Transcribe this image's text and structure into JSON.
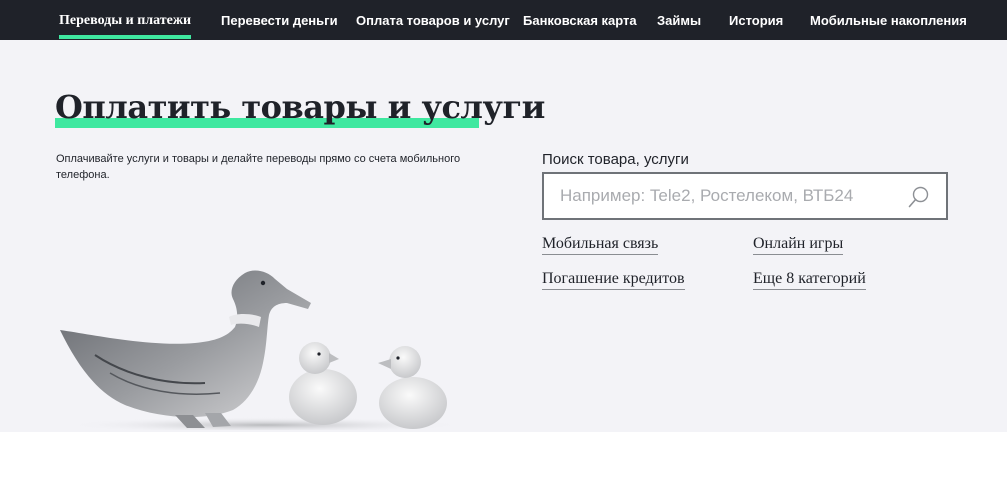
{
  "nav": {
    "items": [
      {
        "label": "Переводы и платежи",
        "active": true
      },
      {
        "label": "Перевести деньги"
      },
      {
        "label": "Оплата товаров и услуг"
      },
      {
        "label": "Банковская карта"
      },
      {
        "label": "Займы"
      },
      {
        "label": "История"
      },
      {
        "label": "Мобильные накопления"
      }
    ]
  },
  "hero": {
    "title": "Оплатить товары и услуги",
    "description": "Оплачивайте услуги и товары и делайте переводы прямо со счета мобильного телефона.",
    "accent_color": "#3fe8a0"
  },
  "search": {
    "label": "Поиск товара, услуги",
    "placeholder": "Например: Tele2, Ростелеком, ВТБ24",
    "value": "",
    "icon": "search-icon"
  },
  "categories": [
    {
      "label": "Мобильная связь"
    },
    {
      "label": "Онлайн игры"
    },
    {
      "label": "Погашение кредитов"
    },
    {
      "label": "Еще 8 категорий"
    }
  ]
}
